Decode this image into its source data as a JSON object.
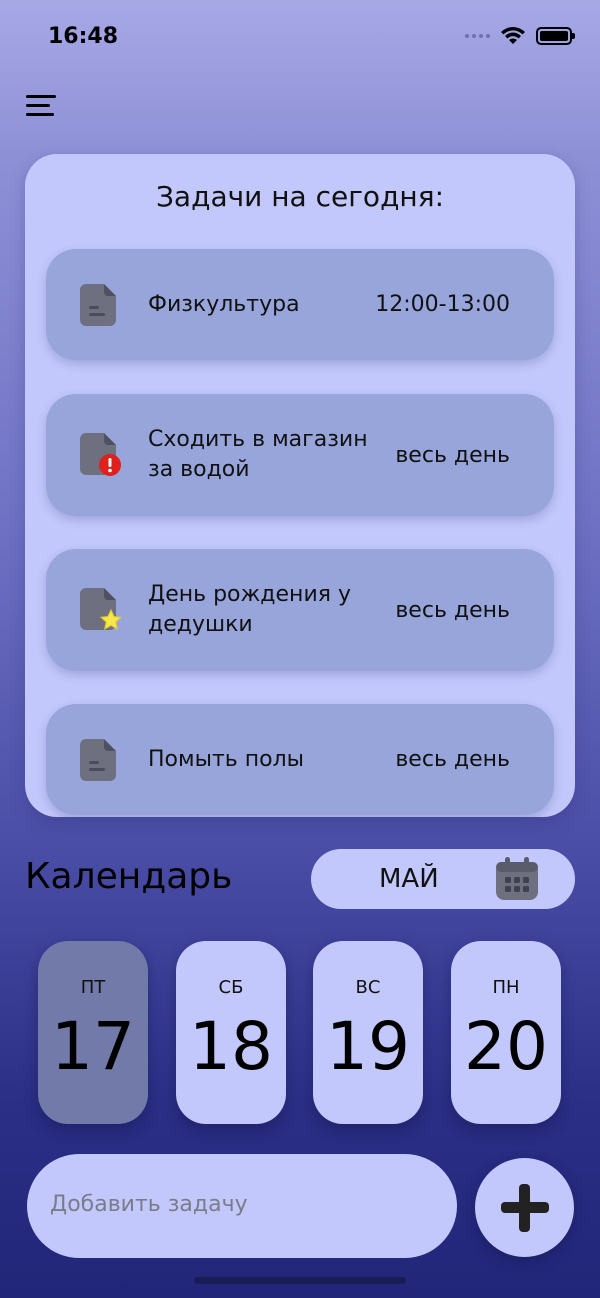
{
  "status": {
    "time": "16:48"
  },
  "tasks_card": {
    "title": "Задачи на сегодня:",
    "tasks": [
      {
        "name": "Физкультура",
        "time": "12:00-13:00",
        "icon": "document-icon"
      },
      {
        "name": "Сходить в магазин за водой",
        "time": "весь день",
        "icon": "document-alert-icon"
      },
      {
        "name": "День рождения у дедушки",
        "time": "весь день",
        "icon": "document-star-icon"
      },
      {
        "name": "Помыть полы",
        "time": "весь день",
        "icon": "document-icon"
      }
    ]
  },
  "calendar": {
    "title": "Календарь",
    "month": "МАЙ",
    "days": [
      {
        "name": "ПТ",
        "number": "17",
        "selected": true
      },
      {
        "name": "СБ",
        "number": "18",
        "selected": false
      },
      {
        "name": "ВС",
        "number": "19",
        "selected": false
      },
      {
        "name": "ПН",
        "number": "20",
        "selected": false
      }
    ]
  },
  "add_task": {
    "placeholder": "Добавить задачу"
  },
  "colors": {
    "card_bg": "#c2c8fb",
    "task_bg": "#97a5db",
    "selected_day_bg": "#717aa8",
    "icon_gray": "#6e7080",
    "alert_red": "#e0201c",
    "star_yellow": "#f6e84a"
  }
}
